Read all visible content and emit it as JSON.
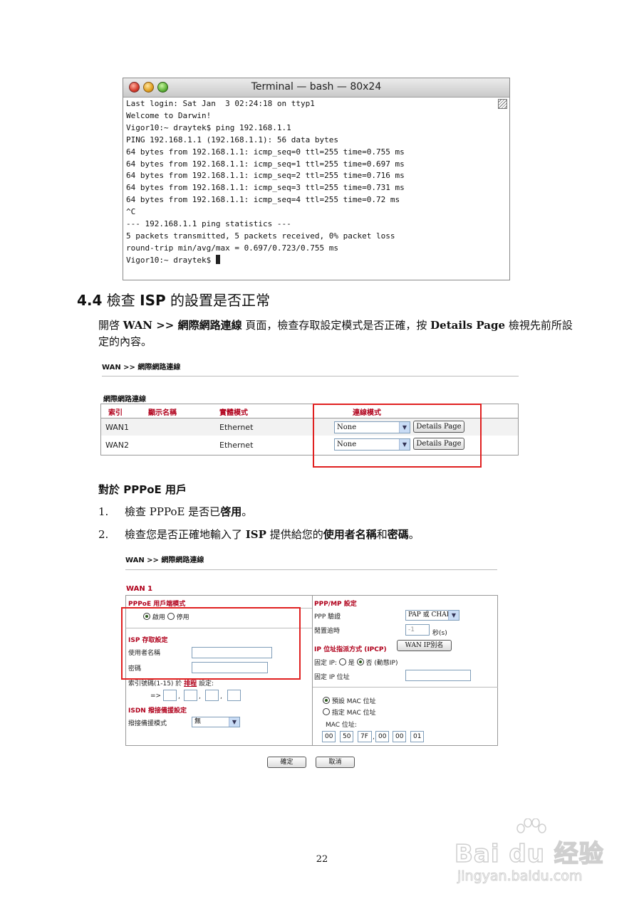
{
  "terminal": {
    "title": "Terminal — bash — 80x24",
    "lines": [
      "Last login: Sat Jan  3 02:24:18 on ttyp1",
      "Welcome to Darwin!",
      "Vigor10:~ draytek$ ping 192.168.1.1",
      "PING 192.168.1.1 (192.168.1.1): 56 data bytes",
      "64 bytes from 192.168.1.1: icmp_seq=0 ttl=255 time=0.755 ms",
      "64 bytes from 192.168.1.1: icmp_seq=1 ttl=255 time=0.697 ms",
      "64 bytes from 192.168.1.1: icmp_seq=2 ttl=255 time=0.716 ms",
      "64 bytes from 192.168.1.1: icmp_seq=3 ttl=255 time=0.731 ms",
      "64 bytes from 192.168.1.1: icmp_seq=4 ttl=255 time=0.72 ms",
      "^C",
      "--- 192.168.1.1 ping statistics ---",
      "5 packets transmitted, 5 packets received, 0% packet loss",
      "round-trip min/avg/max = 0.697/0.723/0.755 ms",
      "Vigor10:~ draytek$ "
    ]
  },
  "section": {
    "number": "4.4",
    "title_pre": " 檢查 ",
    "title_isp": "ISP",
    "title_post": " 的設置是否正常",
    "para_1": "開啓 ",
    "para_wan": "WAN >>  網際網路連線",
    "para_2": " 頁面，檢查存取設定模式是否正確，按 ",
    "para_details": "Details Page",
    "para_3": " 檢視先前所設定的內容。"
  },
  "wan_table": {
    "breadcrumb": "WAN >> 網際網路連線",
    "subtitle": "網際網路連線",
    "headers": [
      "索引",
      "顯示名稱",
      "實體模式",
      "連線模式"
    ],
    "rows": [
      {
        "index": "WAN1",
        "name": "",
        "mode": "Ethernet",
        "connection": "None",
        "button": "Details Page"
      },
      {
        "index": "WAN2",
        "name": "",
        "mode": "Ethernet",
        "connection": "None",
        "button": "Details Page"
      }
    ]
  },
  "pppoe": {
    "heading_1": "對於 ",
    "heading_bold": "PPPoE",
    "heading_2": " 用戶",
    "step1_num": "1.",
    "step1_pre": "檢查 PPPoE 是否已",
    "step1_bold": "啓用",
    "step1_post": "。",
    "step2_num": "2.",
    "step2_pre": "檢查您是否正確地輸入了 ",
    "step2_isp": "ISP",
    "step2_mid": " 提供給您的",
    "step2_user": "使用者名稱",
    "step2_and": "和",
    "step2_pwd": "密碼",
    "step2_post": "。"
  },
  "wan_config": {
    "breadcrumb": "WAN >> 網際網路連線",
    "title": "WAN 1",
    "left": {
      "client_mode": "PPPoE 用戶端模式",
      "enable": "啟用",
      "disable": "停用",
      "isp_settings": "ISP 存取設定",
      "username_label": "使用者名稱",
      "password_label": "密碼",
      "index_label": "索引號碼(1-15) 於 ",
      "schedule_link": "排程",
      "index_suffix": " 設定:",
      "arrow": "=>",
      "isdn_title": "ISDN 撥接備援設定",
      "isdn_mode_label": "撥接備援模式",
      "isdn_mode_value": "無"
    },
    "right": {
      "ppp_title": "PPP/MP 設定",
      "ppp_auth_label": "PPP 驗證",
      "ppp_auth_value": "PAP 或 CHAP",
      "idle_label": "閒置逾時",
      "idle_value": "-1",
      "idle_unit": "秒(s)",
      "ipcp_title": "IP 位址指派方式 (IPCP)",
      "wan_alias_button": "WAN IP別名",
      "fixed_ip_label": "固定 IP:",
      "yes": "是",
      "no": "否",
      "dynamic": "(動態IP)",
      "fixed_ip_addr_label": "固定 IP 位址",
      "default_mac": "預設 MAC 位址",
      "specify_mac": "指定 MAC 位址",
      "mac_label": "MAC 位址:",
      "mac": [
        "00",
        "50",
        "7F",
        "00",
        "00",
        "01"
      ]
    },
    "ok_button": "確定",
    "cancel_button": "取消"
  },
  "page_number": "22",
  "watermark": {
    "logo": "Bai du 经验",
    "url": "jingyan.baidu.com"
  }
}
